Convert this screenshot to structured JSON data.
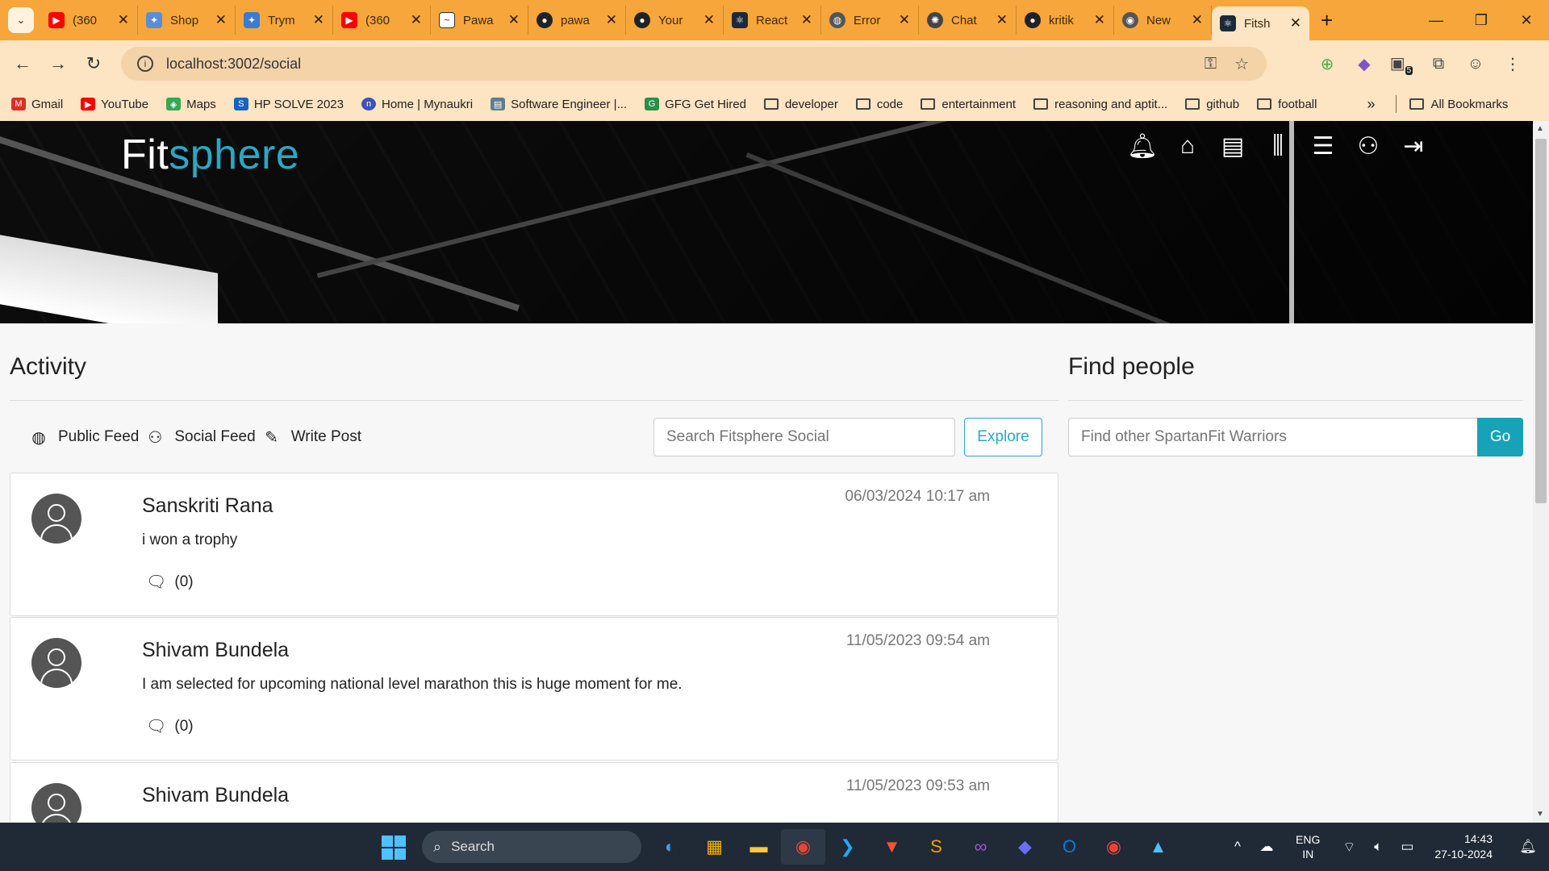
{
  "browser": {
    "tabs": [
      {
        "title": "(360",
        "icon": "youtube-icon",
        "color": "#ff0000"
      },
      {
        "title": "Shop",
        "icon": "bird-icon",
        "color": "#5a8dd6"
      },
      {
        "title": "Trym",
        "icon": "bird-icon",
        "color": "#3b7bd4"
      },
      {
        "title": "(360",
        "icon": "youtube-icon",
        "color": "#ff0000"
      },
      {
        "title": "Pawa",
        "icon": "terminal-icon",
        "color": "#333333"
      },
      {
        "title": "pawa",
        "icon": "github-icon",
        "color": "#222222"
      },
      {
        "title": "Your",
        "icon": "github-icon",
        "color": "#222222"
      },
      {
        "title": "React",
        "icon": "react-icon",
        "color": "#1a2a3a"
      },
      {
        "title": "Error",
        "icon": "globe-icon",
        "color": "#555555"
      },
      {
        "title": "Chat",
        "icon": "chatgpt-icon",
        "color": "#444444"
      },
      {
        "title": "kritik",
        "icon": "github-icon",
        "color": "#222222"
      },
      {
        "title": "New",
        "icon": "chrome-icon",
        "color": "#555555"
      },
      {
        "title": "Fitsh",
        "icon": "react-icon",
        "color": "#1a2a3a",
        "active": true
      }
    ],
    "url": "localhost:3002/social",
    "extension_badge": "5",
    "bookmarks": [
      {
        "label": "Gmail",
        "icon": "gmail-icon",
        "color": "#d93025"
      },
      {
        "label": "YouTube",
        "icon": "youtube-icon",
        "color": "#ff0000"
      },
      {
        "label": "Maps",
        "icon": "maps-icon",
        "color": "#34a853"
      },
      {
        "label": "HP SOLVE 2023",
        "icon": "hp-icon",
        "color": "#1565c0"
      },
      {
        "label": "Home | Mynaukri",
        "icon": "naukri-icon",
        "color": "#3f51b5"
      },
      {
        "label": "Software Engineer |...",
        "icon": "job-icon",
        "color": "#607d8b"
      },
      {
        "label": "GFG Get Hired",
        "icon": "gfg-icon",
        "color": "#2f8d46"
      },
      {
        "label": "developer",
        "icon": "folder-icon"
      },
      {
        "label": "code",
        "icon": "folder-icon"
      },
      {
        "label": "entertainment",
        "icon": "folder-icon"
      },
      {
        "label": "reasoning and aptit...",
        "icon": "folder-icon"
      },
      {
        "label": "github",
        "icon": "folder-icon"
      },
      {
        "label": "football",
        "icon": "folder-icon"
      }
    ],
    "all_bookmarks": "All Bookmarks"
  },
  "app": {
    "brand_part1": "Fit",
    "brand_part2": "sphere",
    "brand_accent": "#2aa8c4",
    "nav_icons": [
      "bell-icon",
      "home-icon",
      "id-card-icon",
      "dumbbell-icon",
      "burger-icon",
      "users-icon",
      "sign-out-icon"
    ]
  },
  "activity": {
    "heading": "Activity",
    "tabs": [
      {
        "label": "Public Feed",
        "icon": "globe-icon"
      },
      {
        "label": "Social Feed",
        "icon": "users-icon"
      },
      {
        "label": "Write Post",
        "icon": "edit-icon"
      }
    ],
    "search_placeholder": "Search Fitsphere Social",
    "explore_label": "Explore"
  },
  "find_people": {
    "heading": "Find people",
    "placeholder": "Find other SpartanFit Warriors",
    "go_label": "Go"
  },
  "posts": [
    {
      "author": "Sanskriti Rana",
      "time": "06/03/2024 10:17 am",
      "body": "i won a trophy",
      "comments": "(0)"
    },
    {
      "author": "Shivam Bundela",
      "time": "11/05/2023 09:54 am",
      "body": "I am selected for upcoming national level marathon this is huge moment for me.",
      "comments": "(0)"
    },
    {
      "author": "Shivam Bundela",
      "time": "11/05/2023 09:53 am",
      "body": "",
      "comments": ""
    }
  ],
  "taskbar": {
    "search_label": "Search",
    "lang_line1": "ENG",
    "lang_line2": "IN",
    "time": "14:43",
    "date": "27-10-2024"
  }
}
